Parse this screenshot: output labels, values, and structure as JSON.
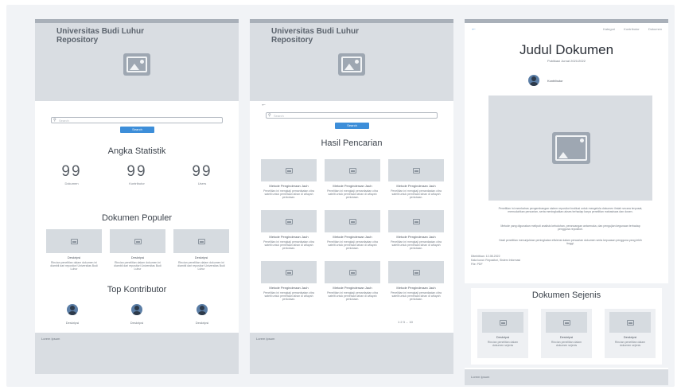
{
  "repo_name": "Universitas Budi Luhur Repository",
  "search": {
    "placeholder": "Search",
    "button_label": "Search"
  },
  "home": {
    "stats_title": "Angka Statistik",
    "stats": [
      {
        "value": "99",
        "label": "Dokumen"
      },
      {
        "value": "99",
        "label": "Kontributor"
      },
      {
        "value": "99",
        "label": "Users"
      }
    ],
    "popular_title": "Dokumen Populer",
    "popular": [
      {
        "title": "Deskripsi",
        "desc": "Rincian penelitian dalam dokumen ini diambil dari repositori Universitas Budi Luhur"
      },
      {
        "title": "Deskripsi",
        "desc": "Rincian penelitian dalam dokumen ini diambil dari repositori Universitas Budi Luhur"
      },
      {
        "title": "Deskripsi",
        "desc": "Rincian penelitian dalam dokumen ini diambil dari repositori Universitas Budi Luhur"
      }
    ],
    "contrib_title": "Top Kontributor",
    "contributors": [
      {
        "name": "Deskripsi"
      },
      {
        "name": "Deskripsi"
      },
      {
        "name": "Deskripsi"
      }
    ],
    "footer": "Lorem Ipsum"
  },
  "results": {
    "title": "Hasil Pencarian",
    "cards": [
      {
        "title": "Metode Penginderaan Jauh",
        "desc": "Penelitian ini mengkaji pemanfaatan citra satelit untuk pemetaan lahan di wilayah perkotaan."
      },
      {
        "title": "Metode Penginderaan Jauh",
        "desc": "Penelitian ini mengkaji pemanfaatan citra satelit untuk pemetaan lahan di wilayah perkotaan."
      },
      {
        "title": "Metode Penginderaan Jauh",
        "desc": "Penelitian ini mengkaji pemanfaatan citra satelit untuk pemetaan lahan di wilayah perkotaan."
      },
      {
        "title": "Metode Penginderaan Jauh",
        "desc": "Penelitian ini mengkaji pemanfaatan citra satelit untuk pemetaan lahan di wilayah perkotaan."
      },
      {
        "title": "Metode Penginderaan Jauh",
        "desc": "Penelitian ini mengkaji pemanfaatan citra satelit untuk pemetaan lahan di wilayah perkotaan."
      },
      {
        "title": "Metode Penginderaan Jauh",
        "desc": "Penelitian ini mengkaji pemanfaatan citra satelit untuk pemetaan lahan di wilayah perkotaan."
      },
      {
        "title": "Metode Penginderaan Jauh",
        "desc": "Penelitian ini mengkaji pemanfaatan citra satelit untuk pemetaan lahan di wilayah perkotaan."
      },
      {
        "title": "Metode Penginderaan Jauh",
        "desc": "Penelitian ini mengkaji pemanfaatan citra satelit untuk pemetaan lahan di wilayah perkotaan."
      },
      {
        "title": "Metode Penginderaan Jauh",
        "desc": "Penelitian ini mengkaji pemanfaatan citra satelit untuk pemetaan lahan di wilayah perkotaan."
      }
    ],
    "pager": "1 2 3 ... 10",
    "footer": "Lorem Ipsum"
  },
  "detail": {
    "nav": [
      "Kategori",
      "Kontributor",
      "Dokumen"
    ],
    "title": "Judul Dokumen",
    "subtitle": "Publikasi Jurnal 2021/2022",
    "author": "Kontributor",
    "abstract": [
      "Penelitian ini membahas pengembangan sistem repositori institusi untuk mengelola dokumen ilmiah secara terpusat, memudahkan pencarian, serta meningkatkan akses terhadap karya penelitian mahasiswa dan dosen.",
      "Metode yang digunakan meliputi analisis kebutuhan, perancangan antarmuka, dan pengujian kegunaan terhadap pengguna repositori.",
      "Hasil penelitian menunjukkan peningkatan efisiensi dalam pencarian dokumen serta kepuasan pengguna yang lebih tinggi."
    ],
    "meta": [
      "Diterbitkan: 12-08-2022",
      "Kata kunci: Repositori, Sistem Informasi",
      "File: PDF"
    ],
    "other_title": "Dokumen Sejenis",
    "others": [
      {
        "title": "Deskripsi",
        "desc": "Rincian penelitian dalam dokumen sejenis"
      },
      {
        "title": "Deskripsi",
        "desc": "Rincian penelitian dalam dokumen sejenis"
      },
      {
        "title": "Deskripsi",
        "desc": "Rincian penelitian dalam dokumen sejenis"
      }
    ],
    "footer": "Lorem Ipsum"
  }
}
